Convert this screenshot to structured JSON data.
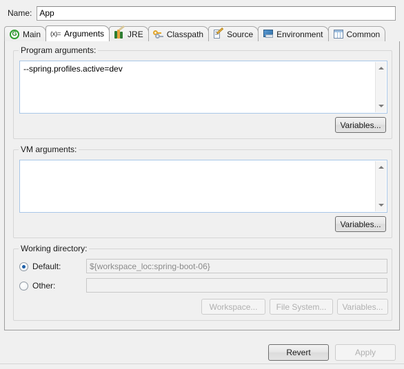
{
  "window": {
    "name_label": "Name:",
    "name_value": "App"
  },
  "tabs": [
    {
      "label": "Main",
      "icon": "java-run-icon",
      "icon_glyph": "G",
      "active": false
    },
    {
      "label": "Arguments",
      "icon": "arguments-icon",
      "icon_glyph": "(x)=",
      "active": true
    },
    {
      "label": "JRE",
      "icon": "jre-books-icon",
      "icon_glyph": "",
      "active": false
    },
    {
      "label": "Classpath",
      "icon": "classpath-keys-icon",
      "icon_glyph": "",
      "active": false
    },
    {
      "label": "Source",
      "icon": "source-pencil-icon",
      "icon_glyph": "",
      "active": false
    },
    {
      "label": "Environment",
      "icon": "environment-monitor-icon",
      "icon_glyph": "",
      "active": false
    },
    {
      "label": "Common",
      "icon": "common-table-icon",
      "icon_glyph": "",
      "active": false
    }
  ],
  "program_arguments": {
    "group_title": "Program arguments:",
    "value": "--spring.profiles.active=dev",
    "variables_button": "Variables..."
  },
  "vm_arguments": {
    "group_title": "VM arguments:",
    "value": "",
    "variables_button": "Variables..."
  },
  "working_directory": {
    "group_title": "Working directory:",
    "default_label": "Default:",
    "default_value": "${workspace_loc:spring-boot-06}",
    "default_selected": true,
    "other_label": "Other:",
    "other_value": "",
    "other_selected": false,
    "workspace_button": "Workspace...",
    "file_system_button": "File System...",
    "variables_button": "Variables..."
  },
  "footer": {
    "revert_button": "Revert",
    "apply_button": "Apply"
  },
  "colors": {
    "dialog_bg": "#f0f0f0",
    "field_bg": "#ffffff",
    "text_border": "#a9c7e8",
    "radio_accent": "#1c5ea8",
    "disabled_text": "#b0b0b0"
  }
}
